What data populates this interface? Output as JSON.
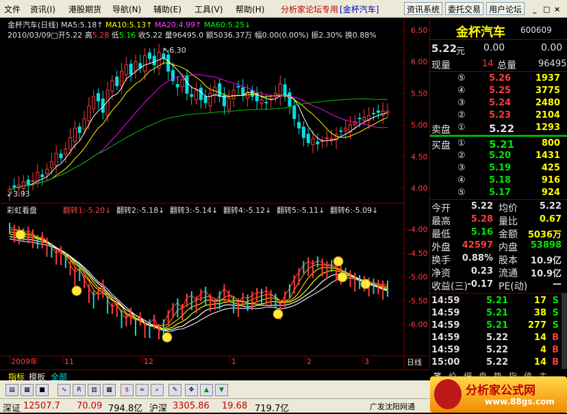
{
  "menu": {
    "items": [
      "文件",
      "资讯(I)",
      "港股期货",
      "导航(N)",
      "辅助(E)",
      "工具(V)",
      "帮助(H)"
    ],
    "forum_label": "分析家论坛专用",
    "stock_badge": "[金杯汽车]",
    "buttons": [
      "资讯系统",
      "委托交易",
      "用户论坛"
    ],
    "window_controls": [
      "_",
      "□",
      "×"
    ]
  },
  "chart": {
    "header_line1": {
      "title": "金杯汽车(日线)",
      "ma5": "MA5:5.18",
      "ma10": "MA10:5.13",
      "ma20": "MA20:4.99",
      "ma60": "MA60:5.25"
    },
    "header_line2": {
      "date": "2010/03/09□",
      "open_label": "开",
      "open": "5.22",
      "high_label": "高",
      "high": "5.28",
      "low_label": "低",
      "low": "5.16",
      "close_label": "收",
      "close": "5.22",
      "vol_label": "量",
      "vol": "96495.0",
      "amt_label": "额",
      "amt": "5036.37万",
      "rng_label": "幅",
      "rng": "0.00(0.00%)",
      "amp_label": "振",
      "amp": "2.30%",
      "turn_label": "换",
      "turn": "0.88%"
    },
    "high_marker": "6.30",
    "low_marker": "3.93",
    "upper_axis": [
      "6.50",
      "6.00",
      "5.50",
      "5.00",
      "4.50",
      "4.00"
    ],
    "lower_title": "彩虹看盘",
    "flips": [
      "翻转1:-5.20",
      "翻转2:-5.18",
      "翻转3:-5.14",
      "翻转4:-5.12",
      "翻转5:-5.11",
      "翻转6:-5.09"
    ],
    "lower_axis": [
      "-4.00",
      "-4.50",
      "-5.00",
      "-5.50",
      "-6.00"
    ],
    "x_labels": [
      "2009年",
      "11",
      "12",
      "1",
      "2",
      "3"
    ],
    "period_label": "日线"
  },
  "chart_data": {
    "type": "candlestick",
    "title": "金杯汽车(日线)",
    "ylim": [
      3.8,
      6.6
    ],
    "moving_averages": [
      {
        "name": "MA5",
        "color": "#ffffff",
        "last": 5.18
      },
      {
        "name": "MA10",
        "color": "#ffff00",
        "last": 5.13
      },
      {
        "name": "MA20",
        "color": "#ff00ff",
        "last": 4.99
      },
      {
        "name": "MA60",
        "color": "#00ff00",
        "last": 5.25
      }
    ],
    "closes": [
      3.98,
      4.02,
      4.05,
      4.1,
      4.06,
      4.12,
      4.25,
      4.18,
      4.3,
      4.42,
      4.55,
      4.48,
      4.62,
      4.8,
      4.95,
      4.88,
      5.1,
      5.3,
      5.45,
      5.38,
      5.2,
      5.55,
      5.7,
      5.62,
      5.85,
      5.95,
      5.8,
      6.0,
      5.9,
      6.1,
      6.05,
      5.95,
      6.15,
      6.05,
      5.85,
      5.7,
      5.6,
      5.72,
      5.5,
      5.45,
      5.55,
      5.4,
      5.35,
      5.5,
      5.6,
      5.45,
      5.3,
      5.42,
      5.55,
      5.6,
      5.48,
      5.52,
      5.45,
      5.38,
      5.4,
      5.35,
      5.42,
      5.5,
      5.65,
      5.45,
      5.3,
      5.1,
      4.95,
      4.8,
      4.72,
      4.78,
      4.7,
      4.75,
      4.8,
      4.78,
      4.85,
      4.9,
      4.95,
      5.0,
      5.05,
      5.1,
      5.12,
      5.15,
      5.18,
      5.2,
      5.22,
      5.22
    ],
    "flip_values": [
      -5.2,
      -5.18,
      -5.14,
      -5.12,
      -5.11,
      -5.09
    ]
  },
  "quote": {
    "name": "金杯汽车",
    "code": "600609",
    "price": "5.22",
    "unit": "元",
    "change": "0.00",
    "change_pct": "0.00",
    "cur_vol_label": "现量",
    "cur_vol": "14",
    "total_vol_label": "总量",
    "total_vol": "96495",
    "asks": [
      {
        "level": "⑤",
        "price": "5.26",
        "vol": "1937"
      },
      {
        "level": "④",
        "price": "5.25",
        "vol": "3775"
      },
      {
        "level": "③",
        "price": "5.24",
        "vol": "2480"
      },
      {
        "level": "②",
        "price": "5.23",
        "vol": "2104"
      },
      {
        "level": "①",
        "price": "5.22",
        "vol": "1293"
      }
    ],
    "ask_label": "卖盘",
    "bid_label": "买盘",
    "bids": [
      {
        "level": "①",
        "price": "5.21",
        "vol": "800"
      },
      {
        "level": "②",
        "price": "5.20",
        "vol": "1431"
      },
      {
        "level": "③",
        "price": "5.19",
        "vol": "425"
      },
      {
        "level": "④",
        "price": "5.18",
        "vol": "916"
      },
      {
        "level": "⑤",
        "price": "5.17",
        "vol": "924"
      }
    ],
    "stats": [
      {
        "l1": "今开",
        "v1": "5.22",
        "l2": "均价",
        "v2": "5.22"
      },
      {
        "l1": "最高",
        "v1": "5.28",
        "l2": "量比",
        "v2": "0.67"
      },
      {
        "l1": "最低",
        "v1": "5.16",
        "l2": "金额",
        "v2": "5036万"
      },
      {
        "l1": "外盘",
        "v1": "42597",
        "l2": "内盘",
        "v2": "53898"
      },
      {
        "l1": "换手",
        "v1": "0.88%",
        "l2": "股本",
        "v2": "10.9亿"
      },
      {
        "l1": "净资",
        "v1": "0.23",
        "l2": "流通",
        "v2": "10.9亿"
      },
      {
        "l1": "收益(三)",
        "v1": "-0.17",
        "l2": "PE(动)",
        "v2": "—"
      }
    ],
    "ticks": [
      {
        "time": "14:59",
        "price": "5.21",
        "vol": "17",
        "side": "S"
      },
      {
        "time": "14:59",
        "price": "5.21",
        "vol": "38",
        "side": "S"
      },
      {
        "time": "14:59",
        "price": "5.21",
        "vol": "277",
        "side": "S"
      },
      {
        "time": "14:59",
        "price": "5.22",
        "vol": "14",
        "side": "B"
      },
      {
        "time": "14:59",
        "price": "5.22",
        "vol": "4",
        "side": "B"
      },
      {
        "time": "15:00",
        "price": "5.22",
        "vol": "14",
        "side": "B"
      }
    ]
  },
  "bottom_tabs": [
    "指标",
    "模板",
    "全部"
  ],
  "right_tabs": [
    "笔",
    "价",
    "细",
    "盘",
    "势",
    "指",
    "值",
    "主"
  ],
  "statusbar": {
    "sz_label": "深证",
    "sz_index": "12507.7",
    "sz_change": "70.09",
    "sz_amount": "794.8亿",
    "hs_label": "沪深",
    "hs_index": "3305.86",
    "hs_change": "19.68",
    "hs_amount": "719.7亿",
    "broker": "广发沈阳网通",
    "logo_text": "分析家公式网",
    "logo_url": "www.88gs.com"
  },
  "colors": {
    "up": "#ff3c3c",
    "down": "#00e0e0",
    "accent": "#c00000"
  }
}
